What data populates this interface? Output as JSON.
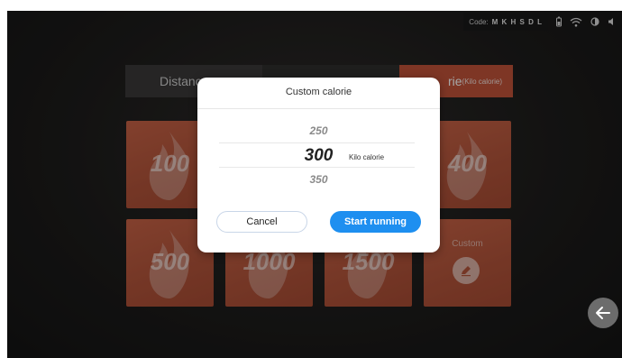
{
  "status_bar": {
    "code_label": "Code:",
    "code_value": "M K H S D L",
    "icons": [
      "battery-icon",
      "wifi-icon",
      "brightness-icon",
      "volume-icon"
    ]
  },
  "tabs": [
    {
      "label": "Distance",
      "active": false
    },
    {
      "label": "",
      "active": false
    },
    {
      "label": "rie",
      "sub": "(Kilo calorie)",
      "active": true
    }
  ],
  "tiles": [
    {
      "value": "100"
    },
    {
      "value": ""
    },
    {
      "value": ""
    },
    {
      "value": "400"
    },
    {
      "value": "500"
    },
    {
      "value": "1000"
    },
    {
      "value": "1500"
    },
    {
      "label": "Custom",
      "icon": "pencil-icon"
    }
  ],
  "dialog": {
    "title": "Custom calorie",
    "picker": {
      "prev": "250",
      "current": "300",
      "next": "350",
      "unit": "Kilo calorie"
    },
    "cancel_label": "Cancel",
    "start_label": "Start running"
  },
  "colors": {
    "tile": "#c05a3f",
    "accent": "#1e8ff0",
    "active_tab": "#c2543a"
  }
}
